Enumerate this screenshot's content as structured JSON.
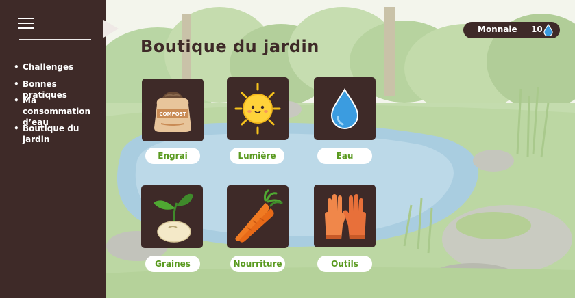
{
  "sidebar": {
    "menu_icon": "hamburger-icon",
    "items": [
      {
        "label": "Challenges"
      },
      {
        "label": "Bonnes pratiques"
      },
      {
        "label": "Ma consommation d’eau"
      },
      {
        "label": "Boutique du jardin"
      }
    ]
  },
  "header": {
    "title": "Boutique du jardin",
    "currency": {
      "label": "Monnaie",
      "value": "10",
      "icon": "water-drop-icon"
    }
  },
  "shop": {
    "items": [
      {
        "label": "Engrai",
        "icon": "compost-bag-icon",
        "bag_text": "COMPOST"
      },
      {
        "label": "Lumière",
        "icon": "sun-icon"
      },
      {
        "label": "Eau",
        "icon": "water-drop-icon"
      },
      {
        "label": "Graines",
        "icon": "seed-sprout-icon"
      },
      {
        "label": "Nourriture",
        "icon": "carrots-icon"
      },
      {
        "label": "Outils",
        "icon": "gardening-gloves-icon"
      }
    ]
  },
  "colors": {
    "sidebar_bg": "#3e2a28",
    "label_green": "#5a9a20",
    "water_blue": "#3b9ce0"
  }
}
